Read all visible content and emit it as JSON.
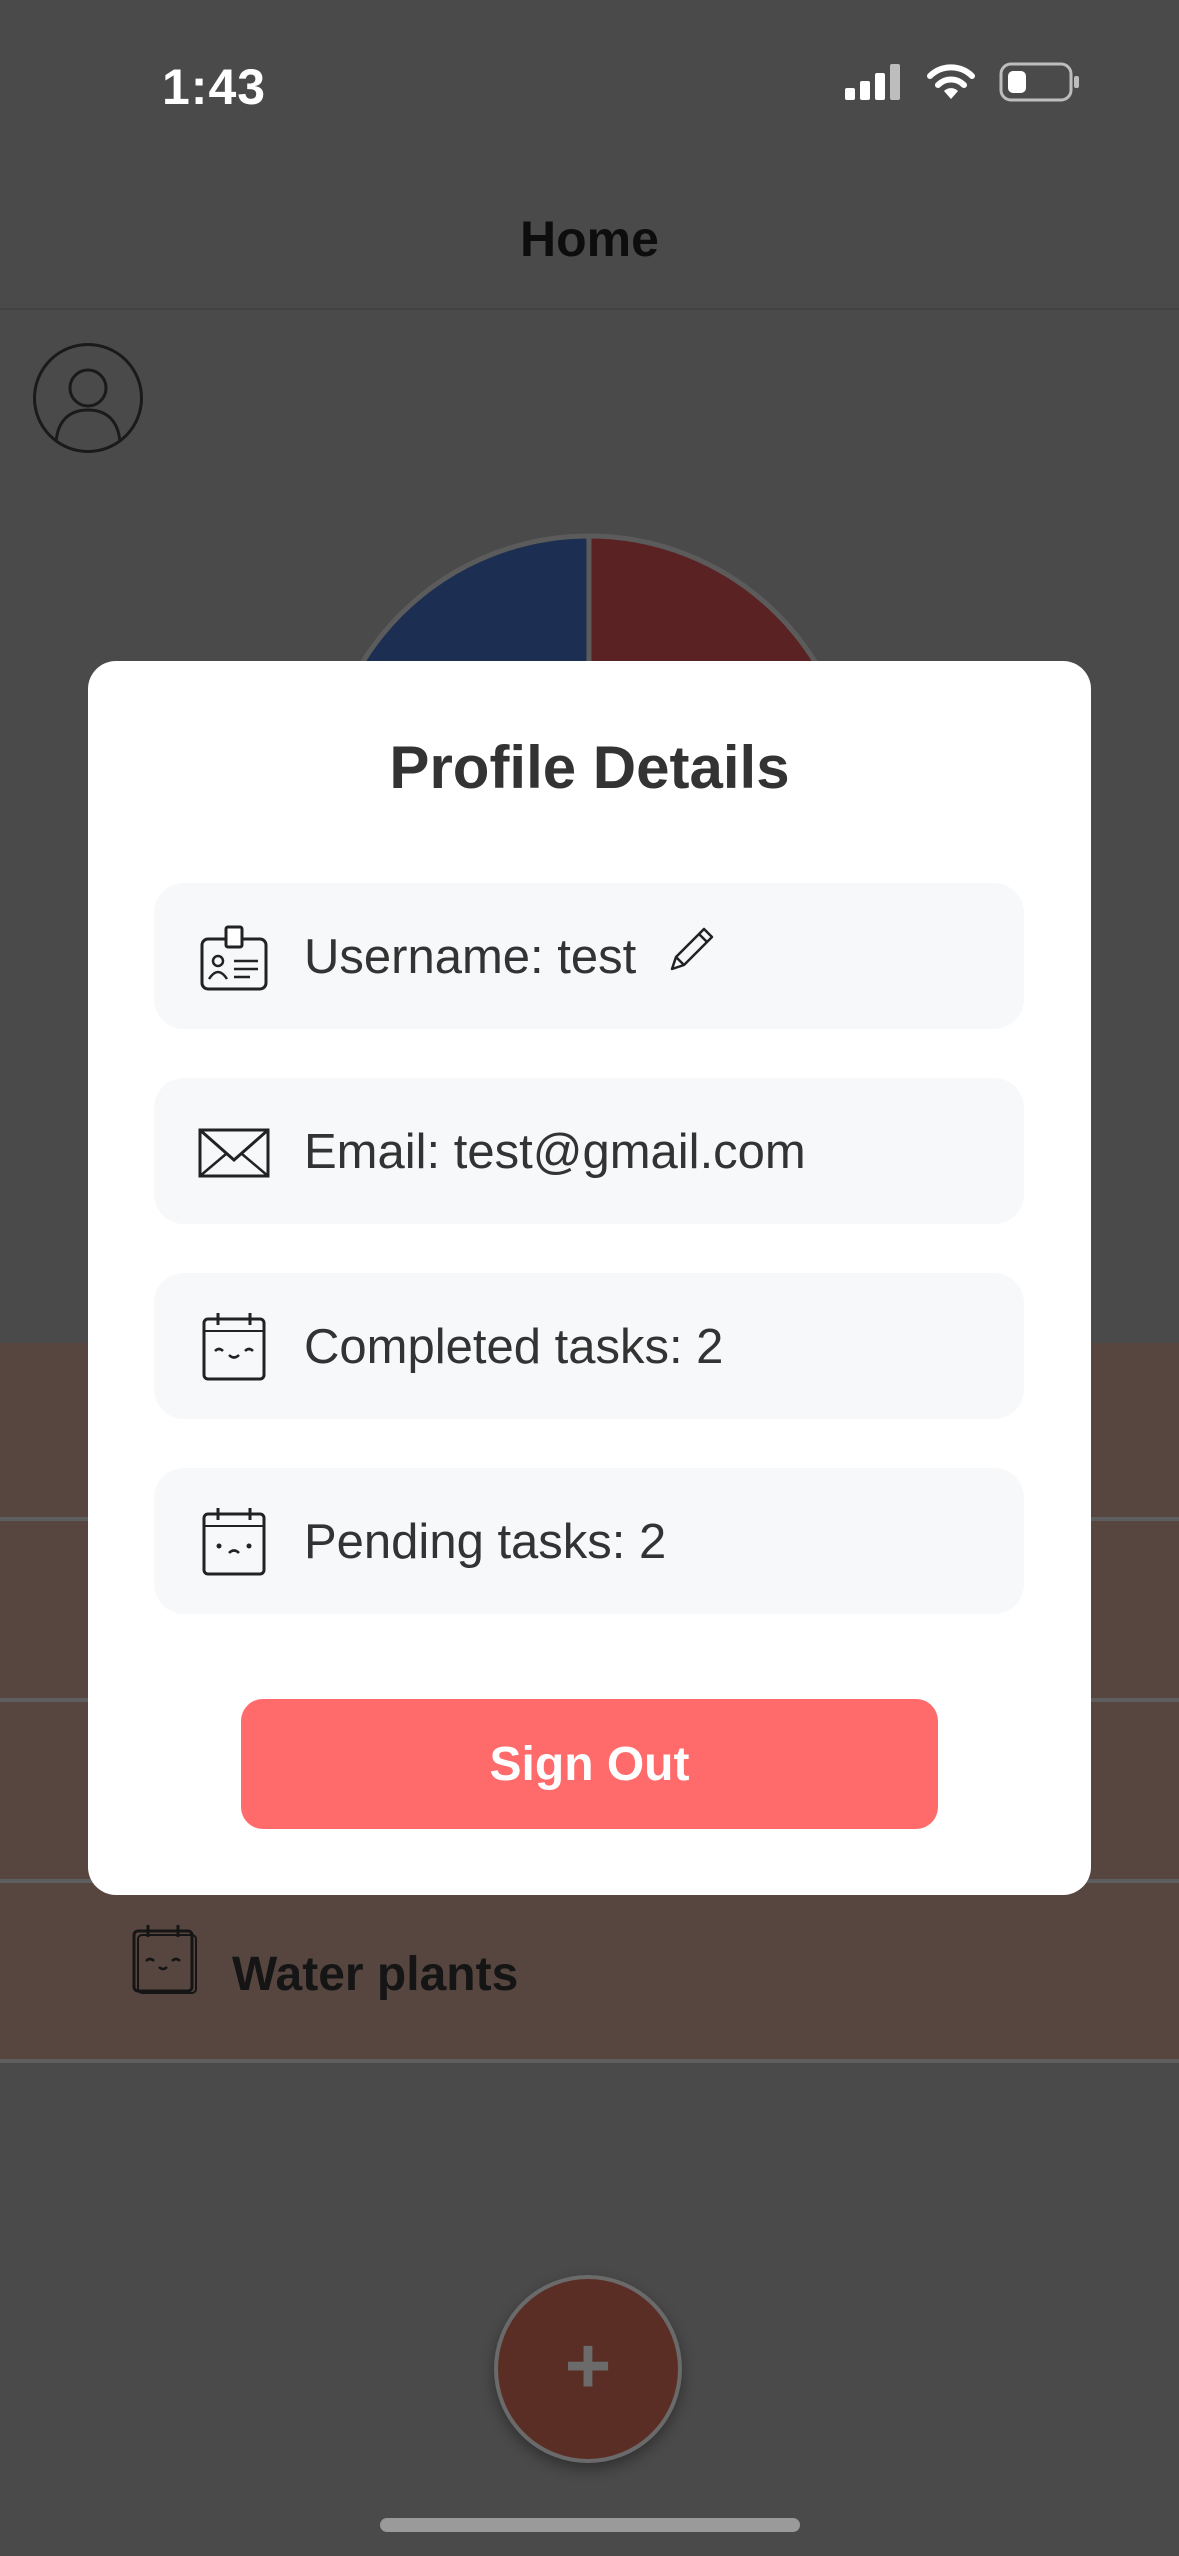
{
  "status_bar": {
    "time": "1:43",
    "icons": [
      "cellular-signal-icon",
      "wifi-icon",
      "battery-icon"
    ]
  },
  "nav": {
    "title": "Home"
  },
  "chart_data": {
    "type": "pie",
    "slices": [
      {
        "color": "#1c2e52"
      },
      {
        "color": "#5a2223"
      }
    ]
  },
  "tasks": {
    "visible_item": {
      "label": "Water plants",
      "icon": "calendar-face-icon"
    }
  },
  "modal": {
    "title": "Profile Details",
    "rows": [
      {
        "icon": "id-badge-icon",
        "text": "Username: test",
        "editable": true,
        "edit_icon": "pencil-icon"
      },
      {
        "icon": "envelope-icon",
        "text": "Email: test@gmail.com"
      },
      {
        "icon": "calendar-happy-icon",
        "text": "Completed tasks: 2"
      },
      {
        "icon": "calendar-sad-icon",
        "text": "Pending tasks: 2"
      }
    ],
    "signout_label": "Sign Out"
  },
  "fab": {
    "label": "+"
  },
  "colors": {
    "overlay_bg": "#4a4a4a",
    "modal_bg": "#ffffff",
    "card_bg": "#f7f8fa",
    "signout": "#ff6b6b",
    "fab": "#5a2e25"
  }
}
